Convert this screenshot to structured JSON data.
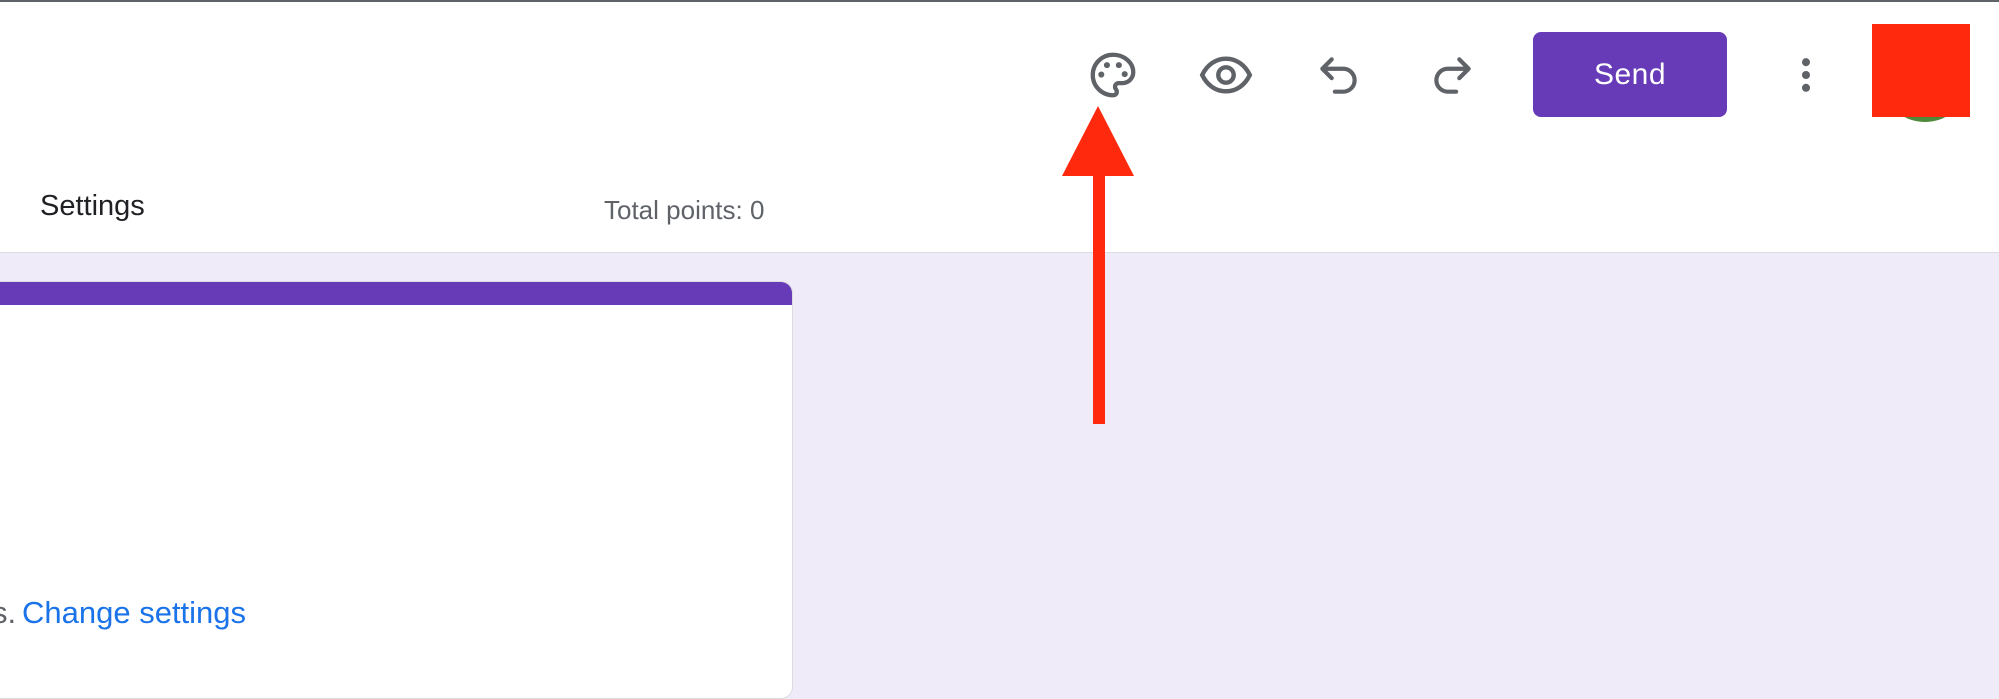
{
  "toolbar": {
    "icons": [
      "palette-icon",
      "eye-icon",
      "undo-icon",
      "redo-icon",
      "more-vert-icon"
    ],
    "send_label": "Send"
  },
  "tabs": {
    "settings_label": "Settings"
  },
  "header": {
    "total_points": "Total points: 0"
  },
  "card": {
    "note_fragment": "s.",
    "change_settings_label": "Change settings"
  },
  "colors": {
    "accent": "#673ab7",
    "background": "#f0ebf8",
    "link": "#1a73e8",
    "icon": "#5f6368",
    "annotation": "#ff2a0e"
  }
}
